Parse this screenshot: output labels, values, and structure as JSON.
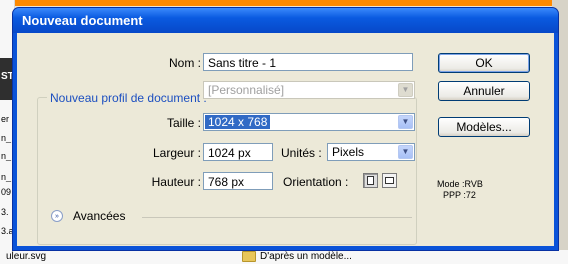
{
  "dialog": {
    "title": "Nouveau document",
    "name_label": "Nom :",
    "name_value": "Sans titre - 1",
    "profile_label": "Nouveau profil de document :",
    "profile_value": "[Personnalisé]",
    "size_label": "Taille :",
    "size_value": "1024 x 768",
    "width_label": "Largeur :",
    "width_value": "1024 px",
    "units_label": "Unités :",
    "units_value": "Pixels",
    "height_label": "Hauteur :",
    "height_value": "768 px",
    "orientation_label": "Orientation :",
    "advanced_label": "Avancées",
    "ok": "OK",
    "cancel": "Annuler",
    "templates": "Modèles...",
    "mode_info": "Mode :RVB",
    "ppp_info": "PPP :72"
  },
  "background": {
    "left_tab": "ST",
    "left_lines": [
      "er",
      "n_",
      "n_",
      "n_",
      "09",
      "3.",
      "3.a"
    ],
    "bottom_file": "uleur.svg",
    "bottom_folder": "D'après un modèle..."
  },
  "colors": {
    "titlebar": "#0a5ae0",
    "client": "#ece9d8",
    "selection": "#316ac5",
    "group_title": "#1c4fc0"
  }
}
